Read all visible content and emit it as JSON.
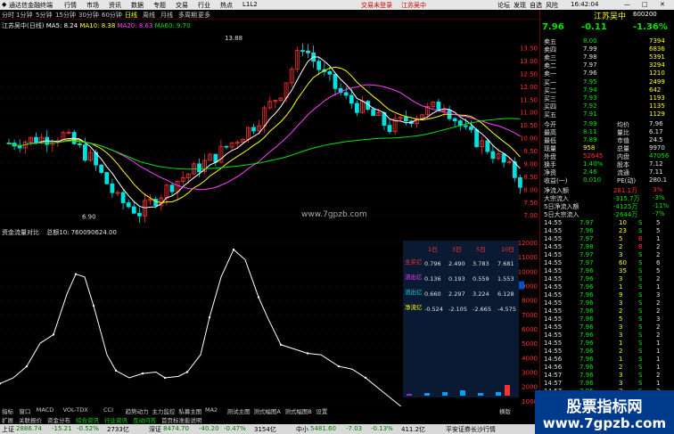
{
  "titlebar": {
    "app": "通达信金融终端",
    "menus": [
      "行情",
      "市场",
      "资讯",
      "数据",
      "专题",
      "交易",
      "行业",
      "热点",
      "L1L2"
    ],
    "notice1": "交易未登录",
    "notice2": "江苏吴中",
    "right": [
      "论坛",
      "发现",
      "自选",
      "风险"
    ],
    "time": "16:42:04"
  },
  "toolbar": {
    "items": [
      "分时",
      "1分钟",
      "5分钟",
      "15分钟",
      "30分钟",
      "60分钟",
      "日线",
      "周线",
      "月线",
      "多周期",
      "更多"
    ],
    "selected": "日线"
  },
  "chart": {
    "stock_line": "江苏吴中(日线)",
    "ma": [
      {
        "label": "MA5: 8.24",
        "color": "#ffffff"
      },
      {
        "label": "MA10: 8.38",
        "color": "#ffff00"
      },
      {
        "label": "MA20: 8.63",
        "color": "#ff40ff"
      },
      {
        "label": "MA60: 9.70",
        "color": "#00e600"
      }
    ],
    "high_label": "13.88",
    "low_label": "6.90",
    "yaxis": [
      "13.50",
      "13.00",
      "12.50",
      "12.00",
      "11.50",
      "11.00",
      "10.50",
      "10.00",
      "9.50",
      "9.00",
      "8.50",
      "8.00",
      "7.50",
      "7.00"
    ],
    "watermark": "www.7gpzb.com",
    "close_price": "7.96",
    "bottom_left": "2024年",
    "bottom_mid": "2024/03/15/五",
    "xmarks": [
      "1",
      "2",
      "3",
      "4",
      "5",
      "6"
    ]
  },
  "subchart": {
    "title": "资金流量对比",
    "total": "总额10: 760090624.00",
    "yaxis": [
      "12000",
      "11000",
      "10000",
      "9000",
      "8000",
      "7000",
      "6000",
      "5000",
      "4000",
      "3000",
      "2000",
      "1000"
    ],
    "current": "9059"
  },
  "table": {
    "headers": [
      "1日",
      "3日",
      "5日",
      "10日"
    ],
    "rows": [
      {
        "label": "主买亿",
        "color": "#ff3232",
        "values": [
          "0.796",
          "2.490",
          "3.783",
          "7.681"
        ]
      },
      {
        "label": "流出亿",
        "color": "#ff40ff",
        "values": [
          "0.136",
          "0.193",
          "0.559",
          "1.553"
        ]
      },
      {
        "label": "流出亿",
        "color": "#00e0e0",
        "values": [
          "0.660",
          "2.297",
          "3.224",
          "6.128"
        ]
      },
      {
        "label": "净流亿",
        "color": "#ffff00",
        "values": [
          "-0.524",
          "-2.105",
          "-2.665",
          "-4.575"
        ]
      }
    ]
  },
  "bottom": {
    "tabs1": [
      "指标",
      "窗口",
      "MACD",
      "VOL-TDX",
      "CCI",
      "趋势动力",
      "主力监控",
      "私募主图",
      "MA2",
      "测试主图",
      "测式幅图A",
      "测式幅图B",
      "设置"
    ],
    "tabs2": [
      "扩展",
      "关联报价",
      "资金分布",
      "综合资讯",
      "行业资讯",
      "互动问答",
      "首页标准能说明"
    ],
    "right": "横版"
  },
  "status": {
    "items": [
      {
        "name": "上证",
        "v": "2886.74",
        "c": "-15.21",
        "p": "-0.52%",
        "a": "2733亿"
      },
      {
        "name": "深证",
        "v": "8474.70",
        "c": "-40.20",
        "p": "-0.47%",
        "a": "3154亿"
      },
      {
        "name": "中小",
        "v": "5481.60",
        "c": "-7.03",
        "p": "-0.13%",
        "a": "411.2亿"
      }
    ],
    "right": "平安证券长沙行情"
  },
  "panel": {
    "name": "江苏吴中",
    "code": "600200",
    "price": "7.96",
    "change": "-0.11",
    "pct": "-1.36%",
    "asks": [
      {
        "n": "卖五",
        "p": "8.00",
        "v": "7394"
      },
      {
        "n": "卖四",
        "p": "7.99",
        "v": "6836"
      },
      {
        "n": "卖三",
        "p": "7.98",
        "v": "5391"
      },
      {
        "n": "卖二",
        "p": "7.97",
        "v": "3294"
      },
      {
        "n": "卖一",
        "p": "7.96",
        "v": "1210"
      }
    ],
    "bids": [
      {
        "n": "买一",
        "p": "7.95",
        "v": "2499"
      },
      {
        "n": "买二",
        "p": "7.94",
        "v": "642"
      },
      {
        "n": "买三",
        "p": "7.93",
        "v": "1193"
      },
      {
        "n": "买四",
        "p": "7.92",
        "v": "1135"
      },
      {
        "n": "买五",
        "p": "7.91",
        "v": "1129"
      }
    ],
    "stats": [
      [
        "今开",
        "7.99",
        "均价",
        "7.96"
      ],
      [
        "最高",
        "8.11",
        "量比",
        "6.17"
      ],
      [
        "最低",
        "7.89",
        "市值",
        "24.5"
      ],
      [
        "现量",
        "958",
        "总量",
        "9970"
      ],
      [
        "外盘",
        "52645",
        "内盘",
        "47056"
      ],
      [
        "换手",
        "1.40%",
        "股本",
        "7.12"
      ],
      [
        "净资",
        "2.46",
        "流通",
        "7.11"
      ],
      [
        "收益(一)",
        "0.010",
        "PE(动)",
        "280.1"
      ]
    ],
    "flows": [
      [
        "净流入额",
        "281.1万",
        "3%"
      ],
      [
        "大宗流入",
        "-315.7万",
        "-3%"
      ],
      [
        "5日净流入额",
        "-4125万",
        "-11%"
      ],
      [
        "5日大宗流入",
        "-2644万",
        "-7%"
      ]
    ],
    "ticks": [
      [
        "14:55",
        "7.97",
        "10",
        "S",
        "5"
      ],
      [
        "14:55",
        "7.96",
        "23",
        "S",
        "5"
      ],
      [
        "14:55",
        "7.97",
        "5",
        "B",
        "1"
      ],
      [
        "14:55",
        "7.98",
        "2",
        "B",
        "2"
      ],
      [
        "14:55",
        "7.97",
        "3",
        "S",
        "2"
      ],
      [
        "14:55",
        "7.97",
        "60",
        "S",
        "6"
      ],
      [
        "14:55",
        "7.96",
        "35",
        "S",
        "5"
      ],
      [
        "14:55",
        "7.96",
        "3",
        "S",
        "2"
      ],
      [
        "14:55",
        "7.96",
        "1",
        "S",
        "1"
      ],
      [
        "14:55",
        "7.96",
        "9",
        "S",
        "3"
      ],
      [
        "14:55",
        "7.96",
        "3",
        "S",
        "2"
      ],
      [
        "14:55",
        "7.96",
        "2",
        "S",
        "2"
      ],
      [
        "14:55",
        "7.96",
        "5",
        "S",
        "3"
      ],
      [
        "14:55",
        "7.96",
        "3",
        "S",
        "2"
      ],
      [
        "14:55",
        "7.96",
        "3",
        "S",
        "2"
      ],
      [
        "14:55",
        "7.96",
        "1",
        "S",
        "1"
      ],
      [
        "14:55",
        "7.96",
        "2",
        "S",
        "1"
      ],
      [
        "14:56",
        "7.96",
        "1",
        "S",
        "1"
      ],
      [
        "14:56",
        "7.96",
        "2",
        "S",
        "1"
      ],
      [
        "14:57",
        "7.96",
        "3",
        "S",
        "2"
      ],
      [
        "14:57",
        "7.96",
        "3",
        "S",
        "1"
      ],
      [
        "14:57",
        "7.96",
        "3",
        "S",
        "2"
      ]
    ]
  },
  "watermark_box": {
    "line1": "股票指标网",
    "line2": "www.7gpzb.com"
  }
}
